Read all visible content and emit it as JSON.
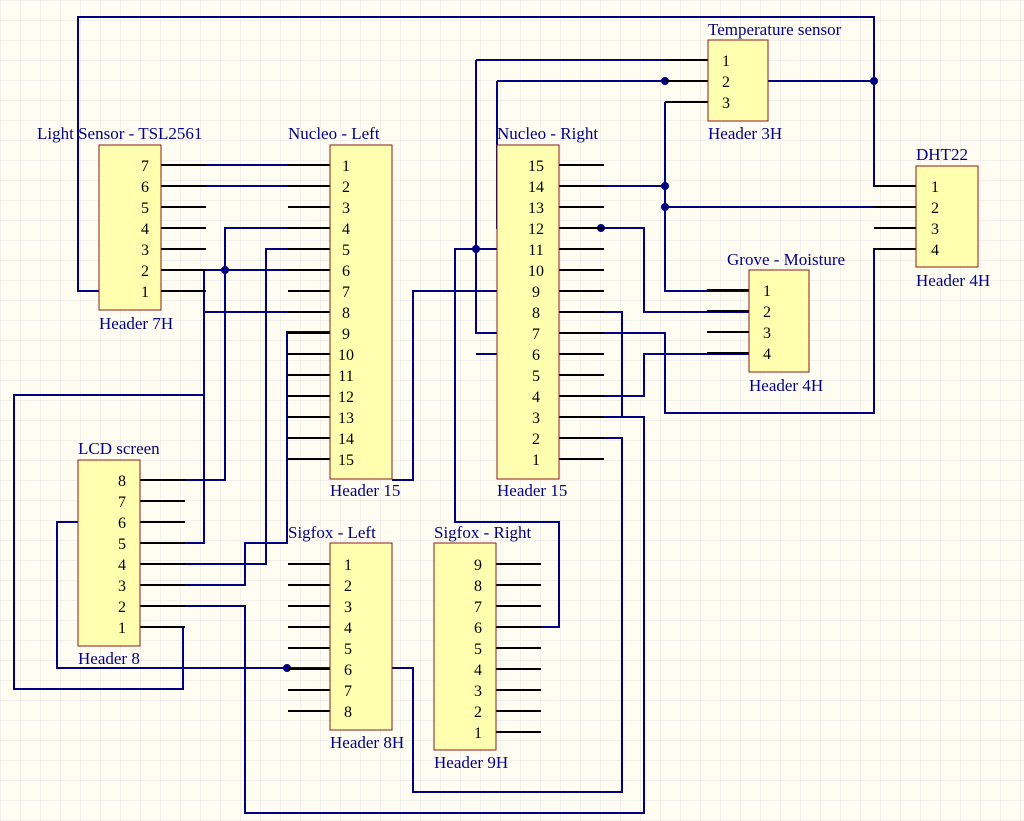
{
  "components": [
    {
      "id": "light",
      "title": "Light Sensor - TSL2561",
      "footer": "Header 7H",
      "pins": [
        "7",
        "6",
        "5",
        "4",
        "3",
        "2",
        "1"
      ]
    },
    {
      "id": "nucleo_left",
      "title": "Nucleo - Left",
      "footer": "Header 15",
      "pins": [
        "1",
        "2",
        "3",
        "4",
        "5",
        "6",
        "7",
        "8",
        "9",
        "10",
        "11",
        "12",
        "13",
        "14",
        "15"
      ]
    },
    {
      "id": "nucleo_right",
      "title": "Nucleo - Right",
      "footer": "Header 15",
      "pins": [
        "15",
        "14",
        "13",
        "12",
        "11",
        "10",
        "9",
        "8",
        "7",
        "6",
        "5",
        "4",
        "3",
        "2",
        "1"
      ]
    },
    {
      "id": "temp",
      "title": "Temperature sensor",
      "footer": "Header 3H",
      "pins": [
        "1",
        "2",
        "3"
      ]
    },
    {
      "id": "dht22",
      "title": "DHT22",
      "footer": "Header 4H",
      "pins": [
        "1",
        "2",
        "3",
        "4"
      ]
    },
    {
      "id": "grove",
      "title": "Grove - Moisture",
      "footer": "Header 4H",
      "pins": [
        "1",
        "2",
        "3",
        "4"
      ]
    },
    {
      "id": "lcd",
      "title": "LCD screen",
      "footer": "Header 8",
      "pins": [
        "8",
        "7",
        "6",
        "5",
        "4",
        "3",
        "2",
        "1"
      ]
    },
    {
      "id": "sigfox_left",
      "title": "Sigfox - Left",
      "footer": "Header 8H",
      "pins": [
        "1",
        "2",
        "3",
        "4",
        "5",
        "6",
        "7",
        "8"
      ]
    },
    {
      "id": "sigfox_right",
      "title": "Sigfox - Right",
      "footer": "Header 9H",
      "pins": [
        "9",
        "8",
        "7",
        "6",
        "5",
        "4",
        "3",
        "2",
        "1"
      ]
    }
  ],
  "colors": {
    "background": "#fffdf2",
    "grid": "#e6e6e6",
    "wire": "#000080",
    "component_fill": "#ffffb0",
    "component_border": "#8b1a1a",
    "pin": "#000000",
    "text": "#000080"
  }
}
